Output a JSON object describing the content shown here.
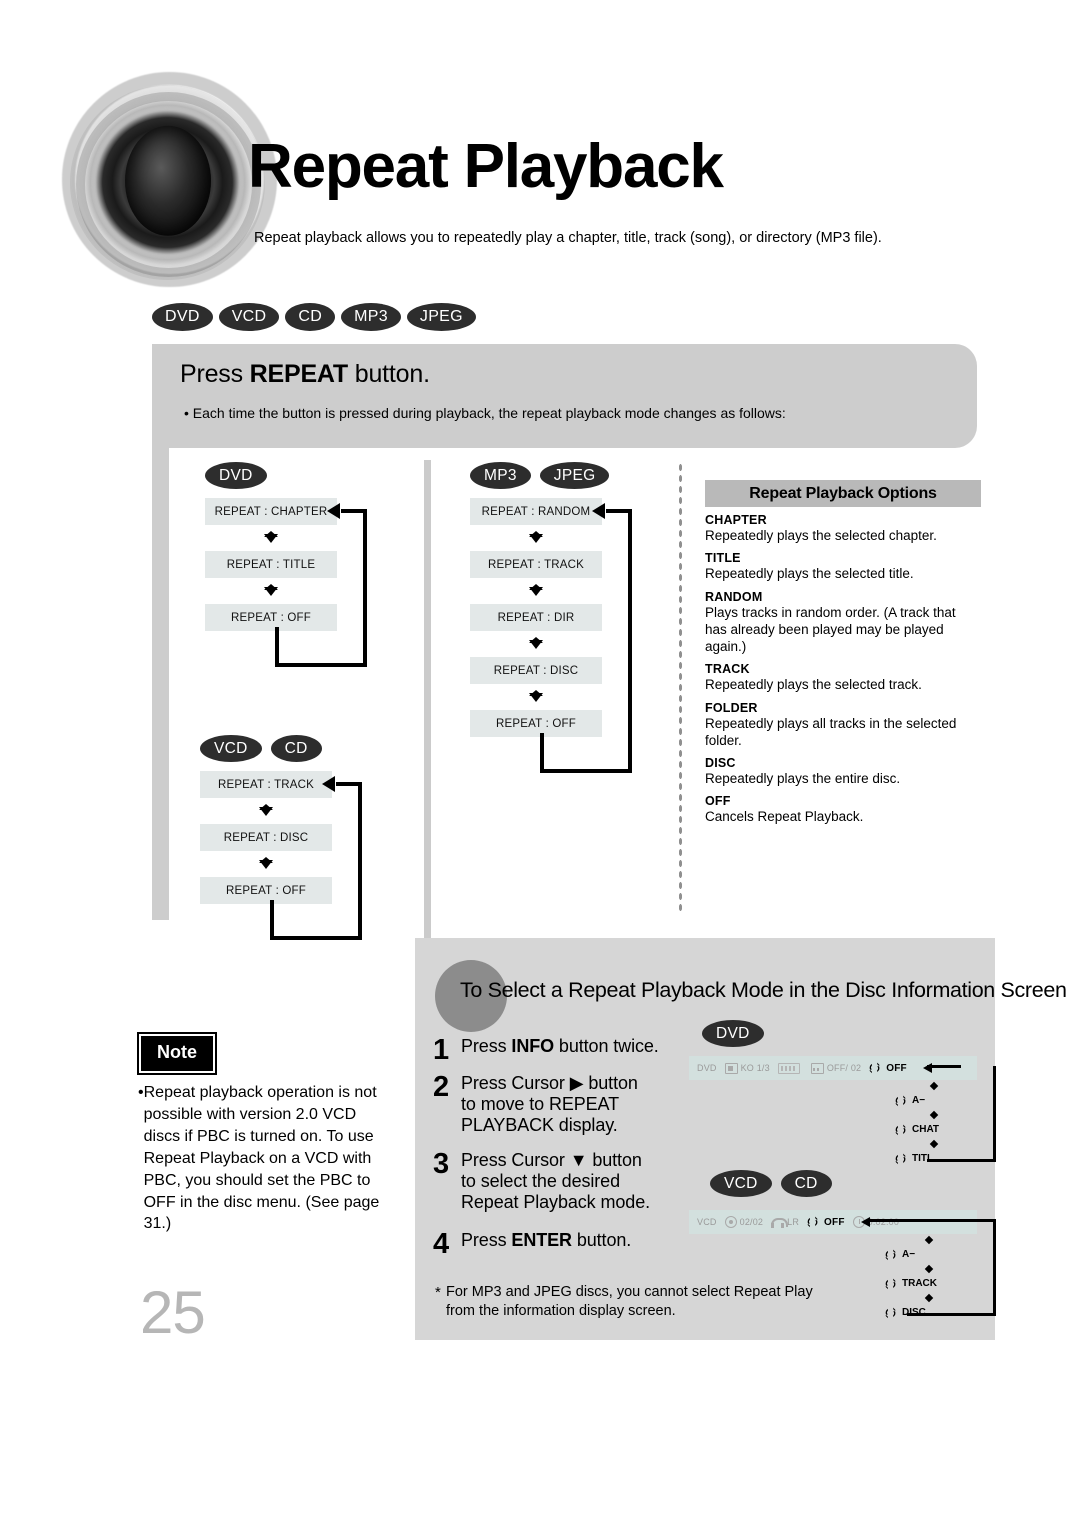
{
  "header": {
    "title": "Repeat Playback",
    "intro": "Repeat playback allows you to repeatedly play a chapter, title, track (song), or directory (MP3 file).",
    "disc_badges": [
      "DVD",
      "VCD",
      "CD",
      "MP3",
      "JPEG"
    ]
  },
  "repeat_panel": {
    "heading_pre": "Press ",
    "heading_bold": "REPEAT",
    "heading_post": " button.",
    "bullet": "• Each time the button is pressed during playback, the repeat playback mode changes as follows:"
  },
  "flows": {
    "dvd": {
      "badges": [
        "DVD"
      ],
      "steps": [
        "REPEAT : CHAPTER",
        "REPEAT : TITLE",
        "REPEAT : OFF"
      ]
    },
    "vcdcd": {
      "badges": [
        "VCD",
        "CD"
      ],
      "steps": [
        "REPEAT : TRACK",
        "REPEAT : DISC",
        "REPEAT : OFF"
      ]
    },
    "mp3jpeg": {
      "badges": [
        "MP3",
        "JPEG"
      ],
      "steps": [
        "REPEAT : RANDOM",
        "REPEAT : TRACK",
        "REPEAT : DIR",
        "REPEAT : DISC",
        "REPEAT : OFF"
      ]
    }
  },
  "options": {
    "title": "Repeat Playback Options",
    "items": [
      {
        "term": "CHAPTER",
        "desc": "Repeatedly plays the selected chapter."
      },
      {
        "term": "TITLE",
        "desc": "Repeatedly plays the selected title."
      },
      {
        "term": "RANDOM",
        "desc": "Plays tracks in random order.\n(A track that has already been played may be played again.)"
      },
      {
        "term": "TRACK",
        "desc": "Repeatedly plays the selected track."
      },
      {
        "term": "FOLDER",
        "desc": "Repeatedly plays all tracks in the selected folder."
      },
      {
        "term": "DISC",
        "desc": "Repeatedly plays the entire disc."
      },
      {
        "term": "OFF",
        "desc": "Cancels Repeat Playback."
      }
    ]
  },
  "bottom": {
    "heading": "To Select a Repeat Playback Mode in the Disc Information Screen",
    "steps": [
      {
        "num": "1",
        "pre": "Press ",
        "bold": "INFO",
        "post": " button twice."
      },
      {
        "num": "2",
        "pre": "Press Cursor ▶ button\nto move to REPEAT\nPLAYBACK display.",
        "bold": "",
        "post": ""
      },
      {
        "num": "3",
        "pre": "Press Cursor ▼ button\nto select the desired\nRepeat Playback mode.",
        "bold": "",
        "post": ""
      },
      {
        "num": "4",
        "pre": "Press ",
        "bold": "ENTER",
        "post": " button."
      }
    ],
    "footnote_star": "*",
    "footnote": "For MP3 and JPEG discs, you cannot select Repeat Play from the information display screen."
  },
  "osd": {
    "dvd": {
      "badges": [
        "DVD"
      ],
      "bar": [
        {
          "label": "DVD",
          "icon": ""
        },
        {
          "label": "KO 1/3",
          "icon": "angle-icon"
        },
        {
          "label": "",
          "icon": "dolby-digital-icon"
        },
        {
          "label": "OFF/ 02",
          "icon": "subtitle-icon"
        },
        {
          "label": "OFF",
          "icon": "repeat-icon",
          "active": true
        }
      ],
      "list": [
        "A−",
        "CHAT",
        "TITL"
      ]
    },
    "vcdcd": {
      "badges": [
        "VCD",
        "CD"
      ],
      "bar": [
        {
          "label": "VCD",
          "icon": ""
        },
        {
          "label": "02/02",
          "icon": "disc-icon"
        },
        {
          "label": "LR",
          "icon": "headphone-icon"
        },
        {
          "label": "OFF",
          "icon": "repeat-icon",
          "active": true
        },
        {
          "label": "0:02:00",
          "icon": "clock-icon"
        }
      ],
      "list": [
        "A−",
        "TRACK",
        "DISC"
      ]
    }
  },
  "note": {
    "label": "Note",
    "bullet": "•",
    "text": "Repeat playback operation is not possible with version 2.0 VCD discs if PBC is turned on. To use Repeat Playback on a VCD with PBC, you should set the PBC to OFF in the disc menu. (See page 31.)"
  },
  "page_number": "25"
}
